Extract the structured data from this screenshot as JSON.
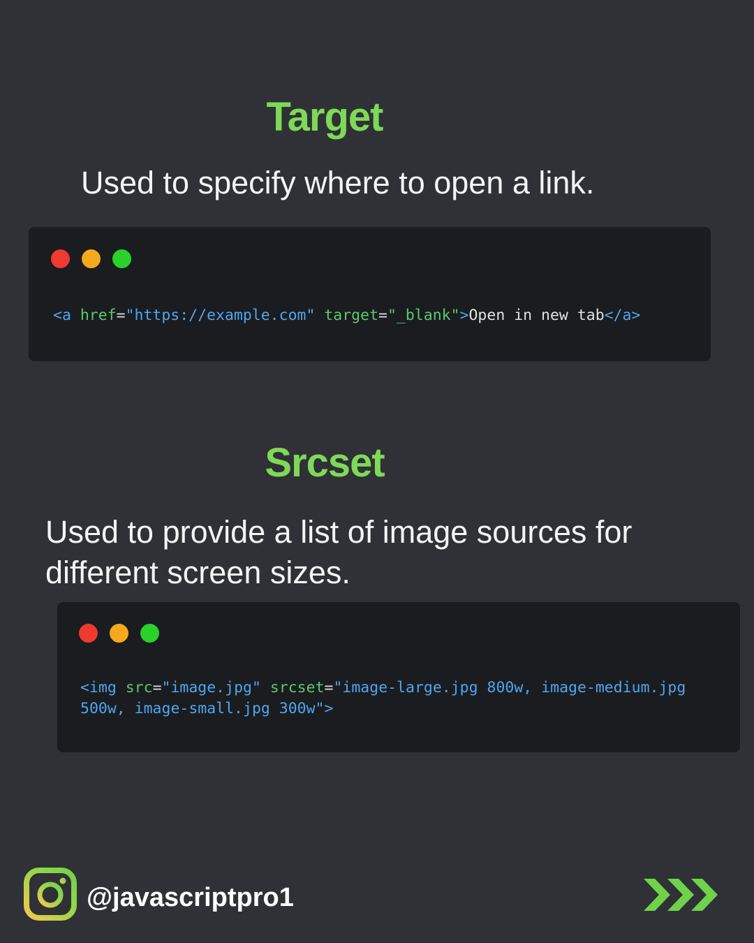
{
  "section1": {
    "title": "Target",
    "description": "Used to specify where to open a link.",
    "code": {
      "tag_open": "<a",
      "attr1_name": " href",
      "attr1_eq": "=",
      "attr1_value": "\"https://example.com\"",
      "attr2_name": " target",
      "attr2_eq": "=",
      "attr2_value": "\"_blank\"",
      "tag_close": ">",
      "text": "Open in new tab",
      "end_tag": "</a>"
    }
  },
  "section2": {
    "title": "Srcset",
    "description": "Used to provide a list of image sources for different screen sizes.",
    "code": {
      "tag_open": "<img",
      "attr1_name": " src",
      "attr1_eq": "=",
      "attr1_value": "\"image.jpg\"",
      "attr2_name": " srcset",
      "attr2_eq": "=",
      "attr2_value": "\"image-large.jpg 800w, image-medium.jpg 500w, image-small.jpg 300w\"",
      "tag_close": ">"
    }
  },
  "footer": {
    "handle": "@javascriptpro1",
    "icon": "instagram-icon",
    "next_icon": "triple-chevron-right-icon"
  },
  "colors": {
    "background": "#2f3136",
    "heading": "#7ed957",
    "code_background": "#1a1c20",
    "code_tag": "#4fa7ef",
    "code_attr": "#5cc96a",
    "dot_red": "#f0392f",
    "dot_yellow": "#f5a91c",
    "dot_green": "#2ad12a"
  }
}
